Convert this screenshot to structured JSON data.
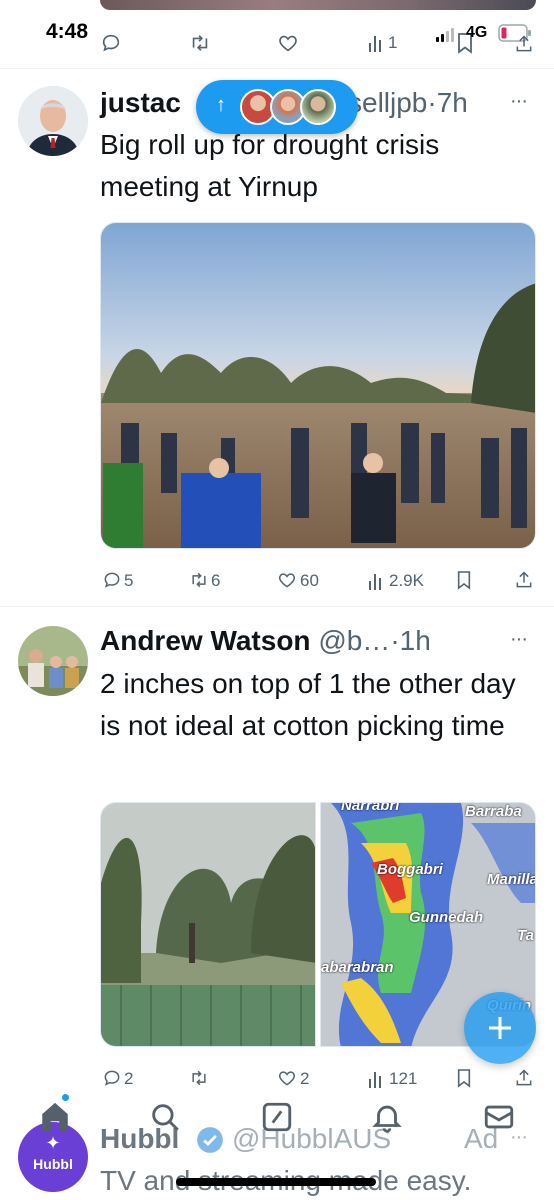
{
  "status_bar": {
    "time": "4:48",
    "network": "4G"
  },
  "top_actions": {
    "views": "1"
  },
  "new_posts_pill": {
    "arrow": "↑"
  },
  "tweets": [
    {
      "name": "justac",
      "handle_tail": "selljpb",
      "time": "7h",
      "text": "Big roll up for drought crisis meeting at Yirnup",
      "replies": "5",
      "retweets": "6",
      "likes": "60",
      "views": "2.9K"
    },
    {
      "name": "Andrew Watson",
      "handle": "@b…",
      "time": "1h",
      "text": "2 inches on top of 1 the other day is not ideal at cotton picking time",
      "replies": "2",
      "retweets": "",
      "likes": "2",
      "views": "121",
      "map_labels": [
        "Narrabri",
        "Barraba",
        "Boggabri",
        "Manilla",
        "Gunnedah",
        "Ta",
        "abarabran",
        "Quirin"
      ]
    }
  ],
  "ad": {
    "name": "Hubbl",
    "handle": "@HubblAUS",
    "label": "Ad",
    "text": "TV and streaming made easy.",
    "avatar_text": "Hubbl"
  },
  "more_glyph": "···",
  "separator": "·",
  "colors": {
    "accent": "#1d9bf0",
    "text": "#0f1419",
    "muted": "#536471",
    "hubbl": "#6a3fd6"
  },
  "icons": [
    "reply-icon",
    "retweet-icon",
    "like-icon",
    "views-icon",
    "bookmark-icon",
    "share-icon",
    "home-icon",
    "search-icon",
    "compose-icon",
    "bell-icon",
    "mail-icon",
    "plus-icon",
    "verified-icon"
  ]
}
